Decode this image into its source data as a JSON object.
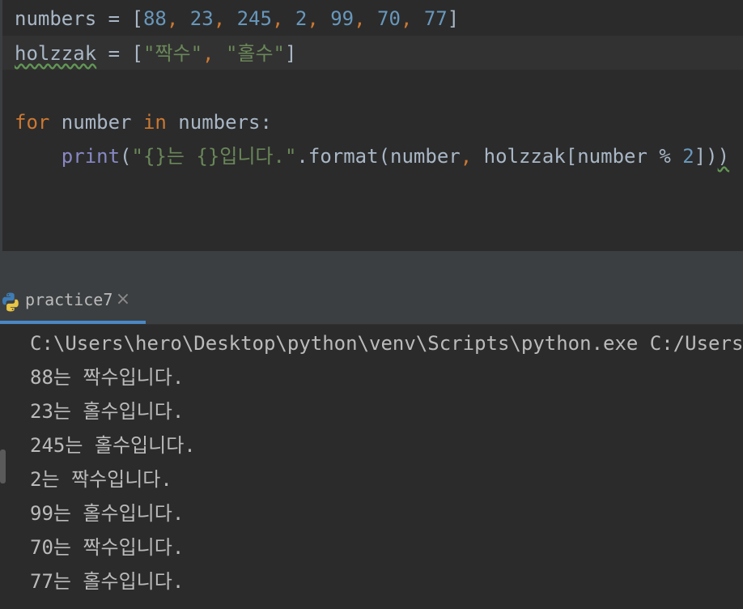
{
  "editor": {
    "line1": {
      "name": "numbers",
      "op": " = ",
      "open": "[",
      "values": [
        "88",
        "23",
        "245",
        "2",
        "99",
        "70",
        "77"
      ],
      "close": "]"
    },
    "line2": {
      "name": "holzzak",
      "op": " = ",
      "open": "[",
      "str1": "\"짝수\"",
      "comma": ", ",
      "str2": "\"홀수\"",
      "close": "]"
    },
    "line4": {
      "kw_for": "for",
      "var": " number ",
      "kw_in": "in",
      "iter": " numbers:"
    },
    "line5": {
      "indent": "    ",
      "func": "print",
      "open": "(",
      "fmt_str": "\"{}는 {}입니다.\"",
      "method": ".format(number",
      "comma": ",",
      "arg": " holzzak[number % ",
      "num": "2",
      "close": "])",
      "last_paren": ")"
    }
  },
  "run_tab": {
    "label": "practice7",
    "close_symbol": "×"
  },
  "console": {
    "command": "C:\\Users\\hero\\Desktop\\python\\venv\\Scripts\\python.exe C:/Users/h",
    "outputs": [
      "88는 짝수입니다.",
      "23는 홀수입니다.",
      "245는 홀수입니다.",
      "2는 짝수입니다.",
      "99는 홀수입니다.",
      "70는 짝수입니다.",
      "77는 홀수입니다."
    ]
  },
  "colors": {
    "background": "#2b2b2b",
    "keyword": "#cc7832",
    "number": "#6897bb",
    "string": "#6a8759",
    "builtin": "#8888c6",
    "text": "#a9b7c6",
    "console_text": "#bbbbbb",
    "tab_underline": "#4a88c7"
  },
  "icons": {
    "tab_icon": "python-icon"
  }
}
